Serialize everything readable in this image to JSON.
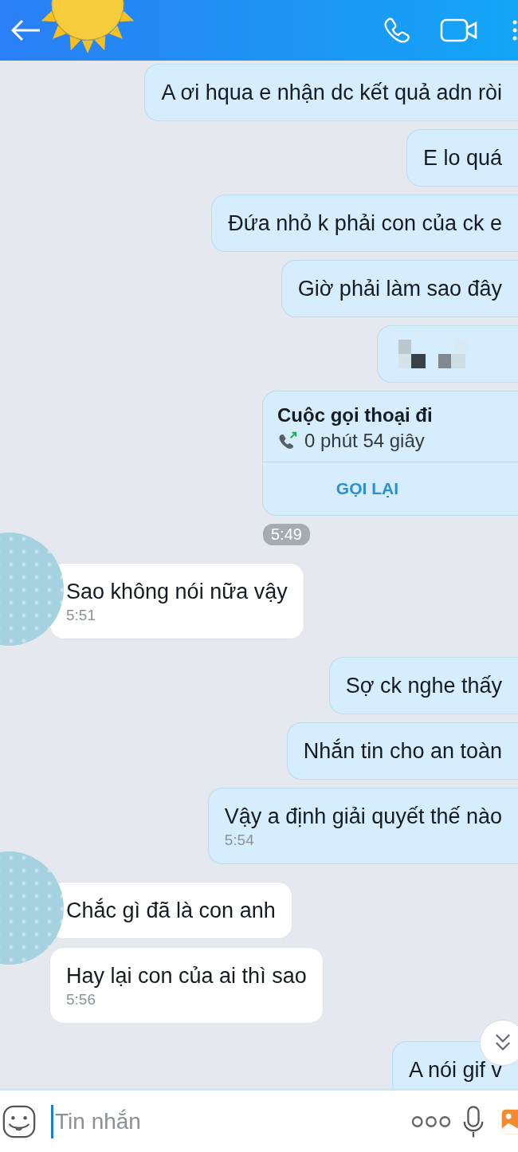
{
  "messages": [
    {
      "kind": "out",
      "text": "A ơi hqua e nhận dc kết quả adn ròi"
    },
    {
      "kind": "out",
      "text": "E lo quá"
    },
    {
      "kind": "out",
      "text": "Đứa nhỏ k phải con của ck e"
    },
    {
      "kind": "out",
      "text": "Giờ phải làm sao đây"
    },
    {
      "kind": "blurred"
    },
    {
      "kind": "call",
      "title": "Cuộc gọi thoại đi",
      "duration": "0 phút 54 giây",
      "action": "GỌI LẠI"
    },
    {
      "kind": "time",
      "text": "5:49"
    },
    {
      "kind": "in",
      "text": "Sao không nói nữa vậy",
      "time": "5:51",
      "avatar": true
    },
    {
      "kind": "out",
      "text": "Sợ ck nghe thấy"
    },
    {
      "kind": "out",
      "text": "Nhắn tin cho an toàn"
    },
    {
      "kind": "out",
      "text": "Vậy a định giải quyết thế nào",
      "time": "5:54"
    },
    {
      "kind": "in",
      "text": "Chắc gì đã là con anh",
      "avatar": true
    },
    {
      "kind": "in",
      "text": "Hay lại con của ai thì sao",
      "time": "5:56",
      "avatar": false
    },
    {
      "kind": "out",
      "text": "A nói gif v"
    }
  ],
  "composer": {
    "placeholder": "Tin nhắn"
  }
}
